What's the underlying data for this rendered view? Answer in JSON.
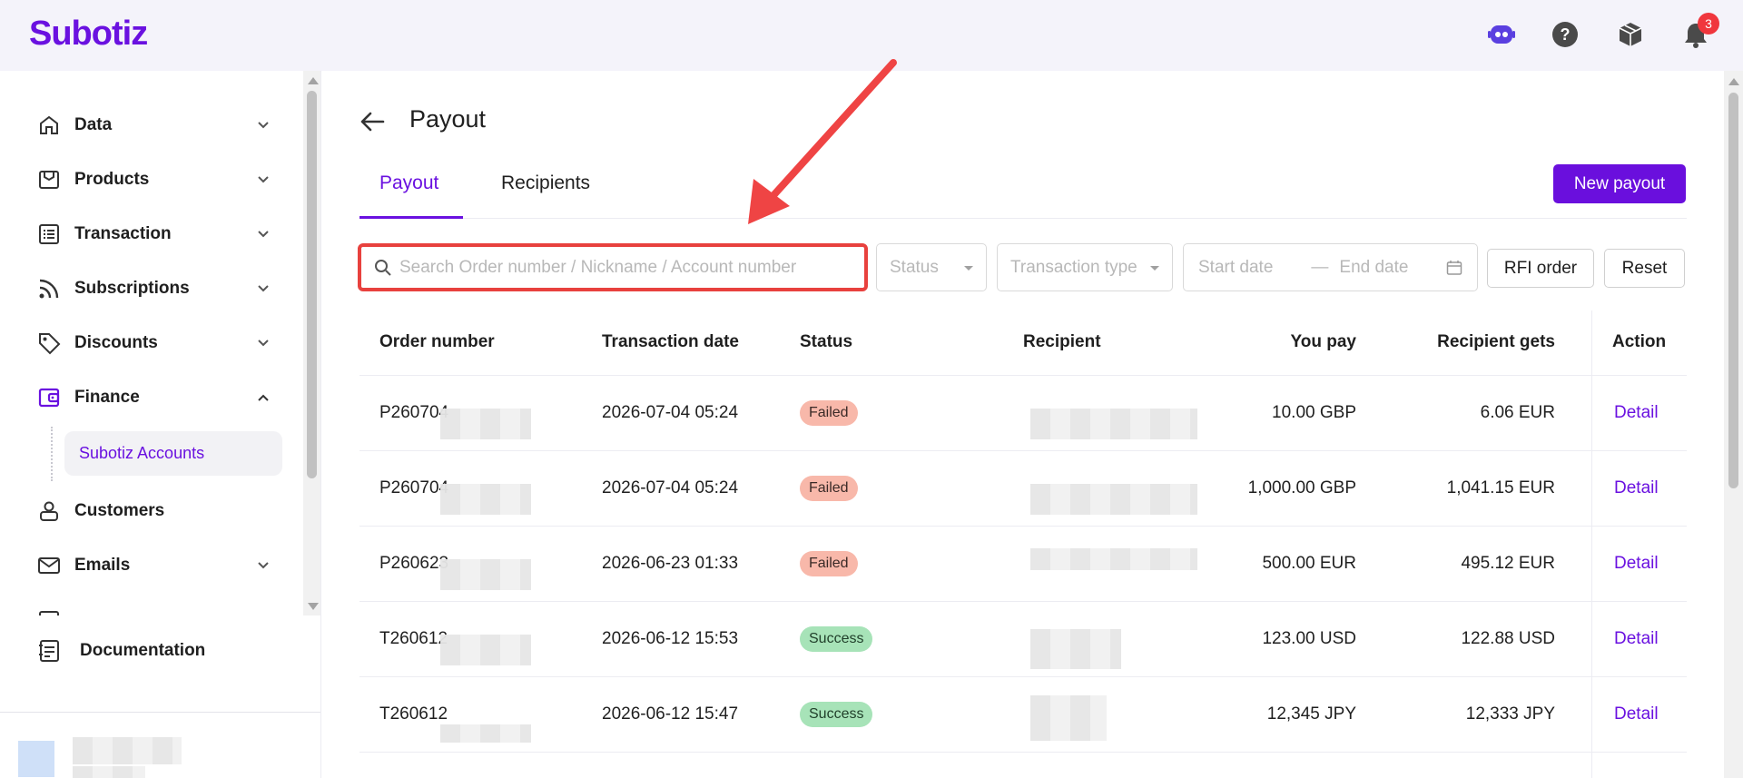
{
  "app": {
    "logo": "Subotiz",
    "notification_count": "3"
  },
  "sidebar": {
    "items": [
      {
        "label": "Data",
        "icon": "home-icon"
      },
      {
        "label": "Products",
        "icon": "store-icon"
      },
      {
        "label": "Transaction",
        "icon": "list-icon"
      },
      {
        "label": "Subscriptions",
        "icon": "rss-icon"
      },
      {
        "label": "Discounts",
        "icon": "tag-icon"
      },
      {
        "label": "Finance",
        "icon": "wallet-icon"
      },
      {
        "label": "Customers",
        "icon": "user-icon"
      },
      {
        "label": "Emails",
        "icon": "mail-icon"
      }
    ],
    "finance_sub": "Subotiz Accounts",
    "documentation": "Documentation"
  },
  "page": {
    "title": "Payout",
    "tabs": [
      "Payout",
      "Recipients"
    ],
    "new_payout": "New payout"
  },
  "filters": {
    "search_placeholder": "Search Order number / Nickname / Account number",
    "status": "Status",
    "transaction_type": "Transaction type",
    "start_date": "Start date",
    "date_separator": "—",
    "end_date": "End date",
    "rfi_order": "RFI order",
    "reset": "Reset"
  },
  "table": {
    "columns": [
      "Order number",
      "Transaction date",
      "Status",
      "Recipient",
      "You pay",
      "Recipient gets",
      "Action"
    ],
    "rows": [
      {
        "order": "P260704",
        "date": "2026-07-04 05:24",
        "status": "Failed",
        "you_pay": "10.00 GBP",
        "gets": "6.06 EUR",
        "action": "Detail"
      },
      {
        "order": "P260704",
        "date": "2026-07-04 05:24",
        "status": "Failed",
        "you_pay": "1,000.00 GBP",
        "gets": "1,041.15 EUR",
        "action": "Detail"
      },
      {
        "order": "P260623",
        "date": "2026-06-23 01:33",
        "status": "Failed",
        "you_pay": "500.00 EUR",
        "gets": "495.12 EUR",
        "action": "Detail"
      },
      {
        "order": "T260612",
        "date": "2026-06-12 15:53",
        "status": "Success",
        "you_pay": "123.00 USD",
        "gets": "122.88 USD",
        "action": "Detail"
      },
      {
        "order": "T260612",
        "date": "2026-06-12 15:47",
        "status": "Success",
        "you_pay": "12,345 JPY",
        "gets": "12,333 JPY",
        "action": "Detail"
      }
    ]
  },
  "colors": {
    "brand": "#6a11e0",
    "highlight": "#e8413e",
    "failed": "#f8b8aa",
    "success": "#a7e3b8"
  }
}
